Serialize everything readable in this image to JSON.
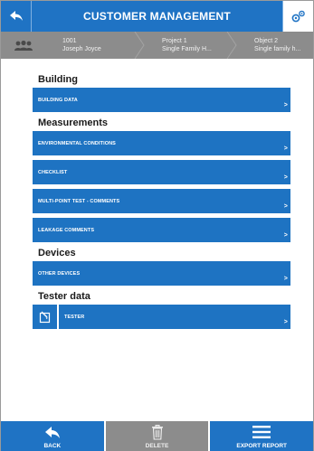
{
  "header": {
    "title": "CUSTOMER MANAGEMENT",
    "back_icon": "arrow-left-icon",
    "settings_icon": "gear-icon"
  },
  "breadcrumb": {
    "avatar_icon": "group-icon",
    "items": [
      {
        "line1": "1001",
        "line2": "Joseph Joyce"
      },
      {
        "line1": "Project 1",
        "line2": "Single Family H..."
      },
      {
        "line1": "Object 2",
        "line2": "Single family h..."
      }
    ]
  },
  "sections": {
    "building": {
      "title": "Building",
      "items": [
        "BUILDING DATA"
      ]
    },
    "measurements": {
      "title": "Measurements",
      "items": [
        "ENVIRONMENTAL CONDITIONS",
        "CHECKLIST",
        "MULTI-POINT TEST - COMMENTS",
        "LEAKAGE COMMENTS"
      ]
    },
    "devices": {
      "title": "Devices",
      "items": [
        "OTHER DEVICES"
      ]
    },
    "tester": {
      "title": "Tester data",
      "items": [
        "TESTER"
      ],
      "icon": "edit-icon"
    }
  },
  "chevron": ">",
  "footer": {
    "back_label": "BACK",
    "delete_label": "DELETE",
    "export_label": "EXPORT REPORT"
  },
  "colors": {
    "primary": "#1f73c4",
    "disabled": "#8c8c8c"
  }
}
